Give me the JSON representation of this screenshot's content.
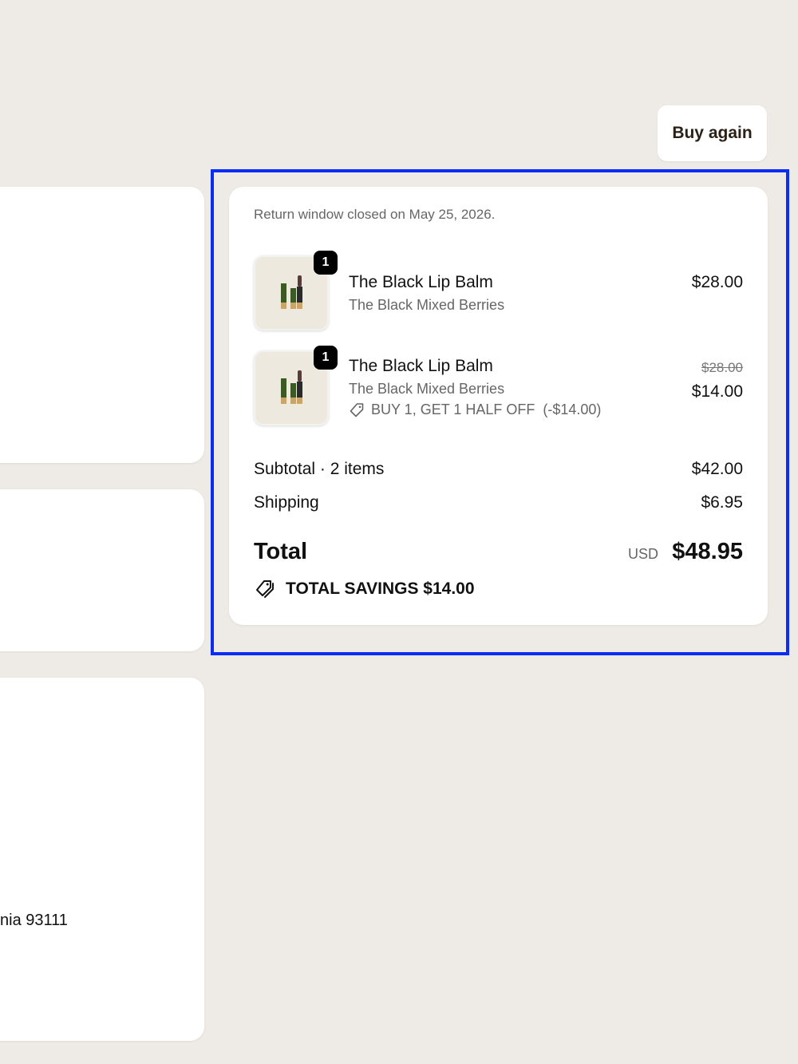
{
  "left_panel": {
    "address_fragment": "nia 93111"
  },
  "header": {
    "buy_again_label": "Buy again"
  },
  "summary": {
    "return_note": "Return window closed on May 25, 2026.",
    "items": [
      {
        "quantity": "1",
        "title": "The Black Lip Balm",
        "variant": "The Black Mixed Berries",
        "price": "$28.00"
      },
      {
        "quantity": "1",
        "title": "The Black Lip Balm",
        "variant": "The Black Mixed Berries",
        "discount": "BUY 1, GET 1 HALF OFF  (-$14.00)",
        "original_price": "$28.00",
        "price": "$14.00"
      }
    ],
    "subtotal_label": "Subtotal · 2 items",
    "subtotal_value": "$42.00",
    "shipping_label": "Shipping",
    "shipping_value": "$6.95",
    "total_label": "Total",
    "total_currency": "USD",
    "total_value": "$48.95",
    "savings_label": "TOTAL SAVINGS $14.00"
  },
  "colors": {
    "background": "#eeeae5",
    "highlight_border": "#0a2cf5",
    "product_tube": "#3c5a24",
    "product_gold": "#c9a56a"
  }
}
